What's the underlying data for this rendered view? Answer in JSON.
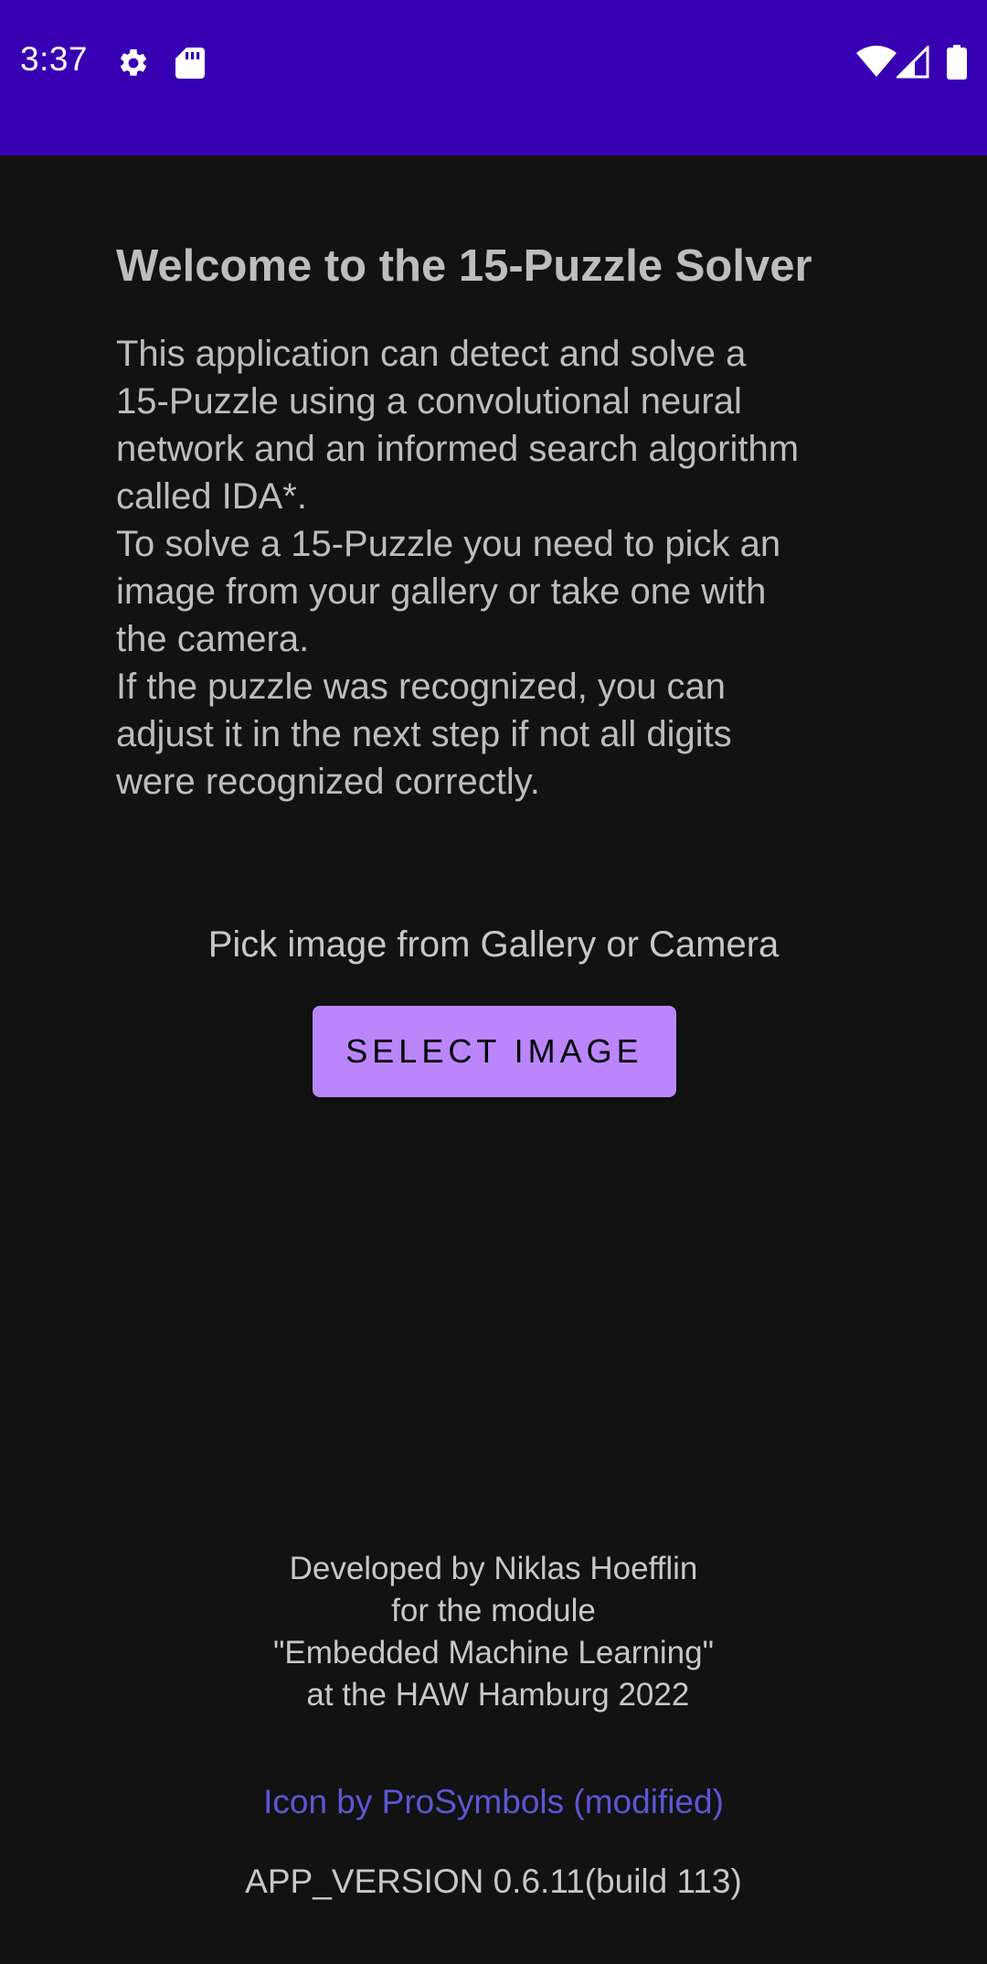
{
  "status_bar": {
    "time": "3:37",
    "icons": [
      "gear-icon",
      "sd-card-icon",
      "wifi-icon",
      "signal-icon",
      "battery-icon"
    ],
    "background_color": "#3700b3"
  },
  "main": {
    "title": "Welcome to the 15-Puzzle Solver",
    "description_lines": [
      "This application can detect and solve a",
      "15-Puzzle using a convolutional neural",
      "network and an informed search algorithm",
      "called IDA*.",
      "To solve a 15-Puzzle you need to pick an",
      "image from your gallery or take one with",
      "the camera.",
      "If the puzzle was recognized, you can",
      "adjust it in the next step if not all digits",
      "were recognized correctly."
    ],
    "pick_label": "Pick image from Gallery or Camera",
    "select_button_label": "SELECT IMAGE",
    "button_color": "#bb86fc"
  },
  "footer": {
    "credits_lines": [
      "Developed by Niklas Hoefflin",
      "for the module",
      "\"Embedded Machine Learning\"",
      " at the HAW Hamburg 2022"
    ],
    "icon_credit": "Icon by ProSymbols (modified)",
    "icon_credit_color": "#5c57d6",
    "app_version": "APP_VERSION 0.6.11(build 113)"
  },
  "theme": {
    "background": "#121212",
    "text": "#bdbdbd"
  }
}
